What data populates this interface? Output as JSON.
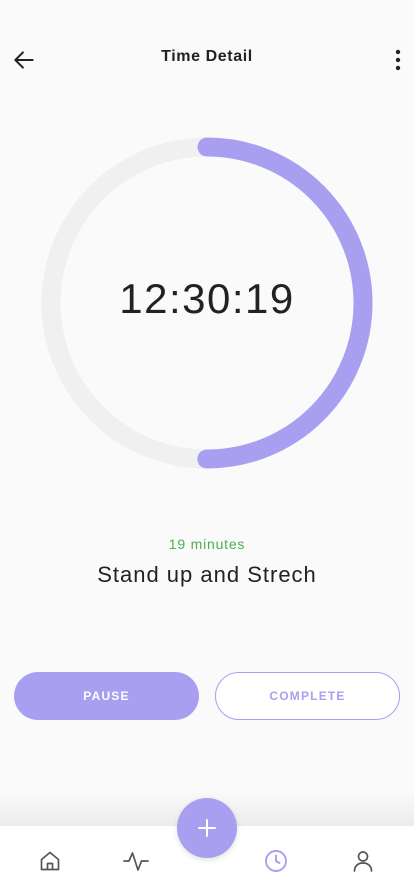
{
  "header": {
    "title": "Time Detail"
  },
  "timer": {
    "time": "12:30:19",
    "progress": 0.5
  },
  "task": {
    "duration": "19 minutes",
    "name": "Stand up and Strech"
  },
  "actions": {
    "pause_label": "PAUSE",
    "complete_label": "COMPLETE"
  },
  "colors": {
    "accent": "#a99ff0",
    "track": "#f0f0f0",
    "duration_text": "#4caf50"
  },
  "nav": {
    "items": [
      "home-icon",
      "activity-icon",
      "add-icon",
      "clock-icon",
      "profile-icon"
    ],
    "active": "clock-icon"
  }
}
